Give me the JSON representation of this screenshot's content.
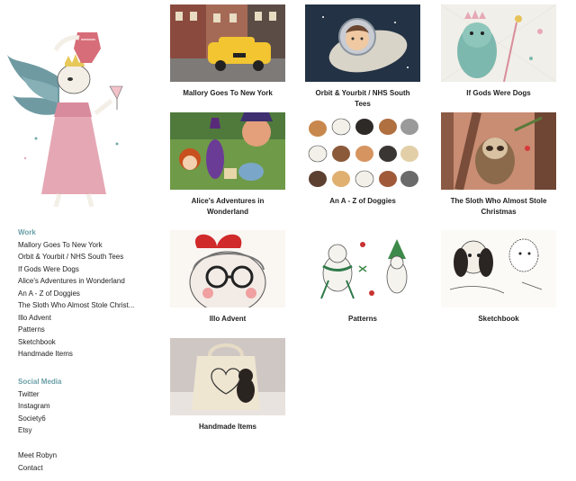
{
  "sidebar": {
    "work_heading": "Work",
    "work_items": [
      "Mallory Goes To New York",
      "Orbit & Yourbit / NHS South Tees",
      "If Gods Were Dogs",
      "Alice's Adventures in Wonderland",
      "An A - Z of Doggies",
      "The Sloth Who Almost Stole Christ...",
      "Illo Advent",
      "Patterns",
      "Sketchbook",
      "Handmade Items"
    ],
    "social_heading": "Social Media",
    "social_items": [
      "Twitter",
      "Instagram",
      "Society6",
      "Etsy"
    ],
    "extra_items": [
      "Meet Robyn",
      "Contact"
    ]
  },
  "gallery": [
    {
      "caption": "Mallory Goes To New York"
    },
    {
      "caption": "Orbit & Yourbit / NHS South Tees"
    },
    {
      "caption": "If Gods Were Dogs"
    },
    {
      "caption": "Alice's Adventures in Wonderland"
    },
    {
      "caption": "An A - Z of Doggies"
    },
    {
      "caption": "The Sloth Who Almost Stole Christmas"
    },
    {
      "caption": "Illo Advent"
    },
    {
      "caption": "Patterns"
    },
    {
      "caption": "Sketchbook"
    },
    {
      "caption": "Handmade Items"
    }
  ],
  "colors": {
    "accent": "#6aa0a8",
    "text": "#222222"
  }
}
